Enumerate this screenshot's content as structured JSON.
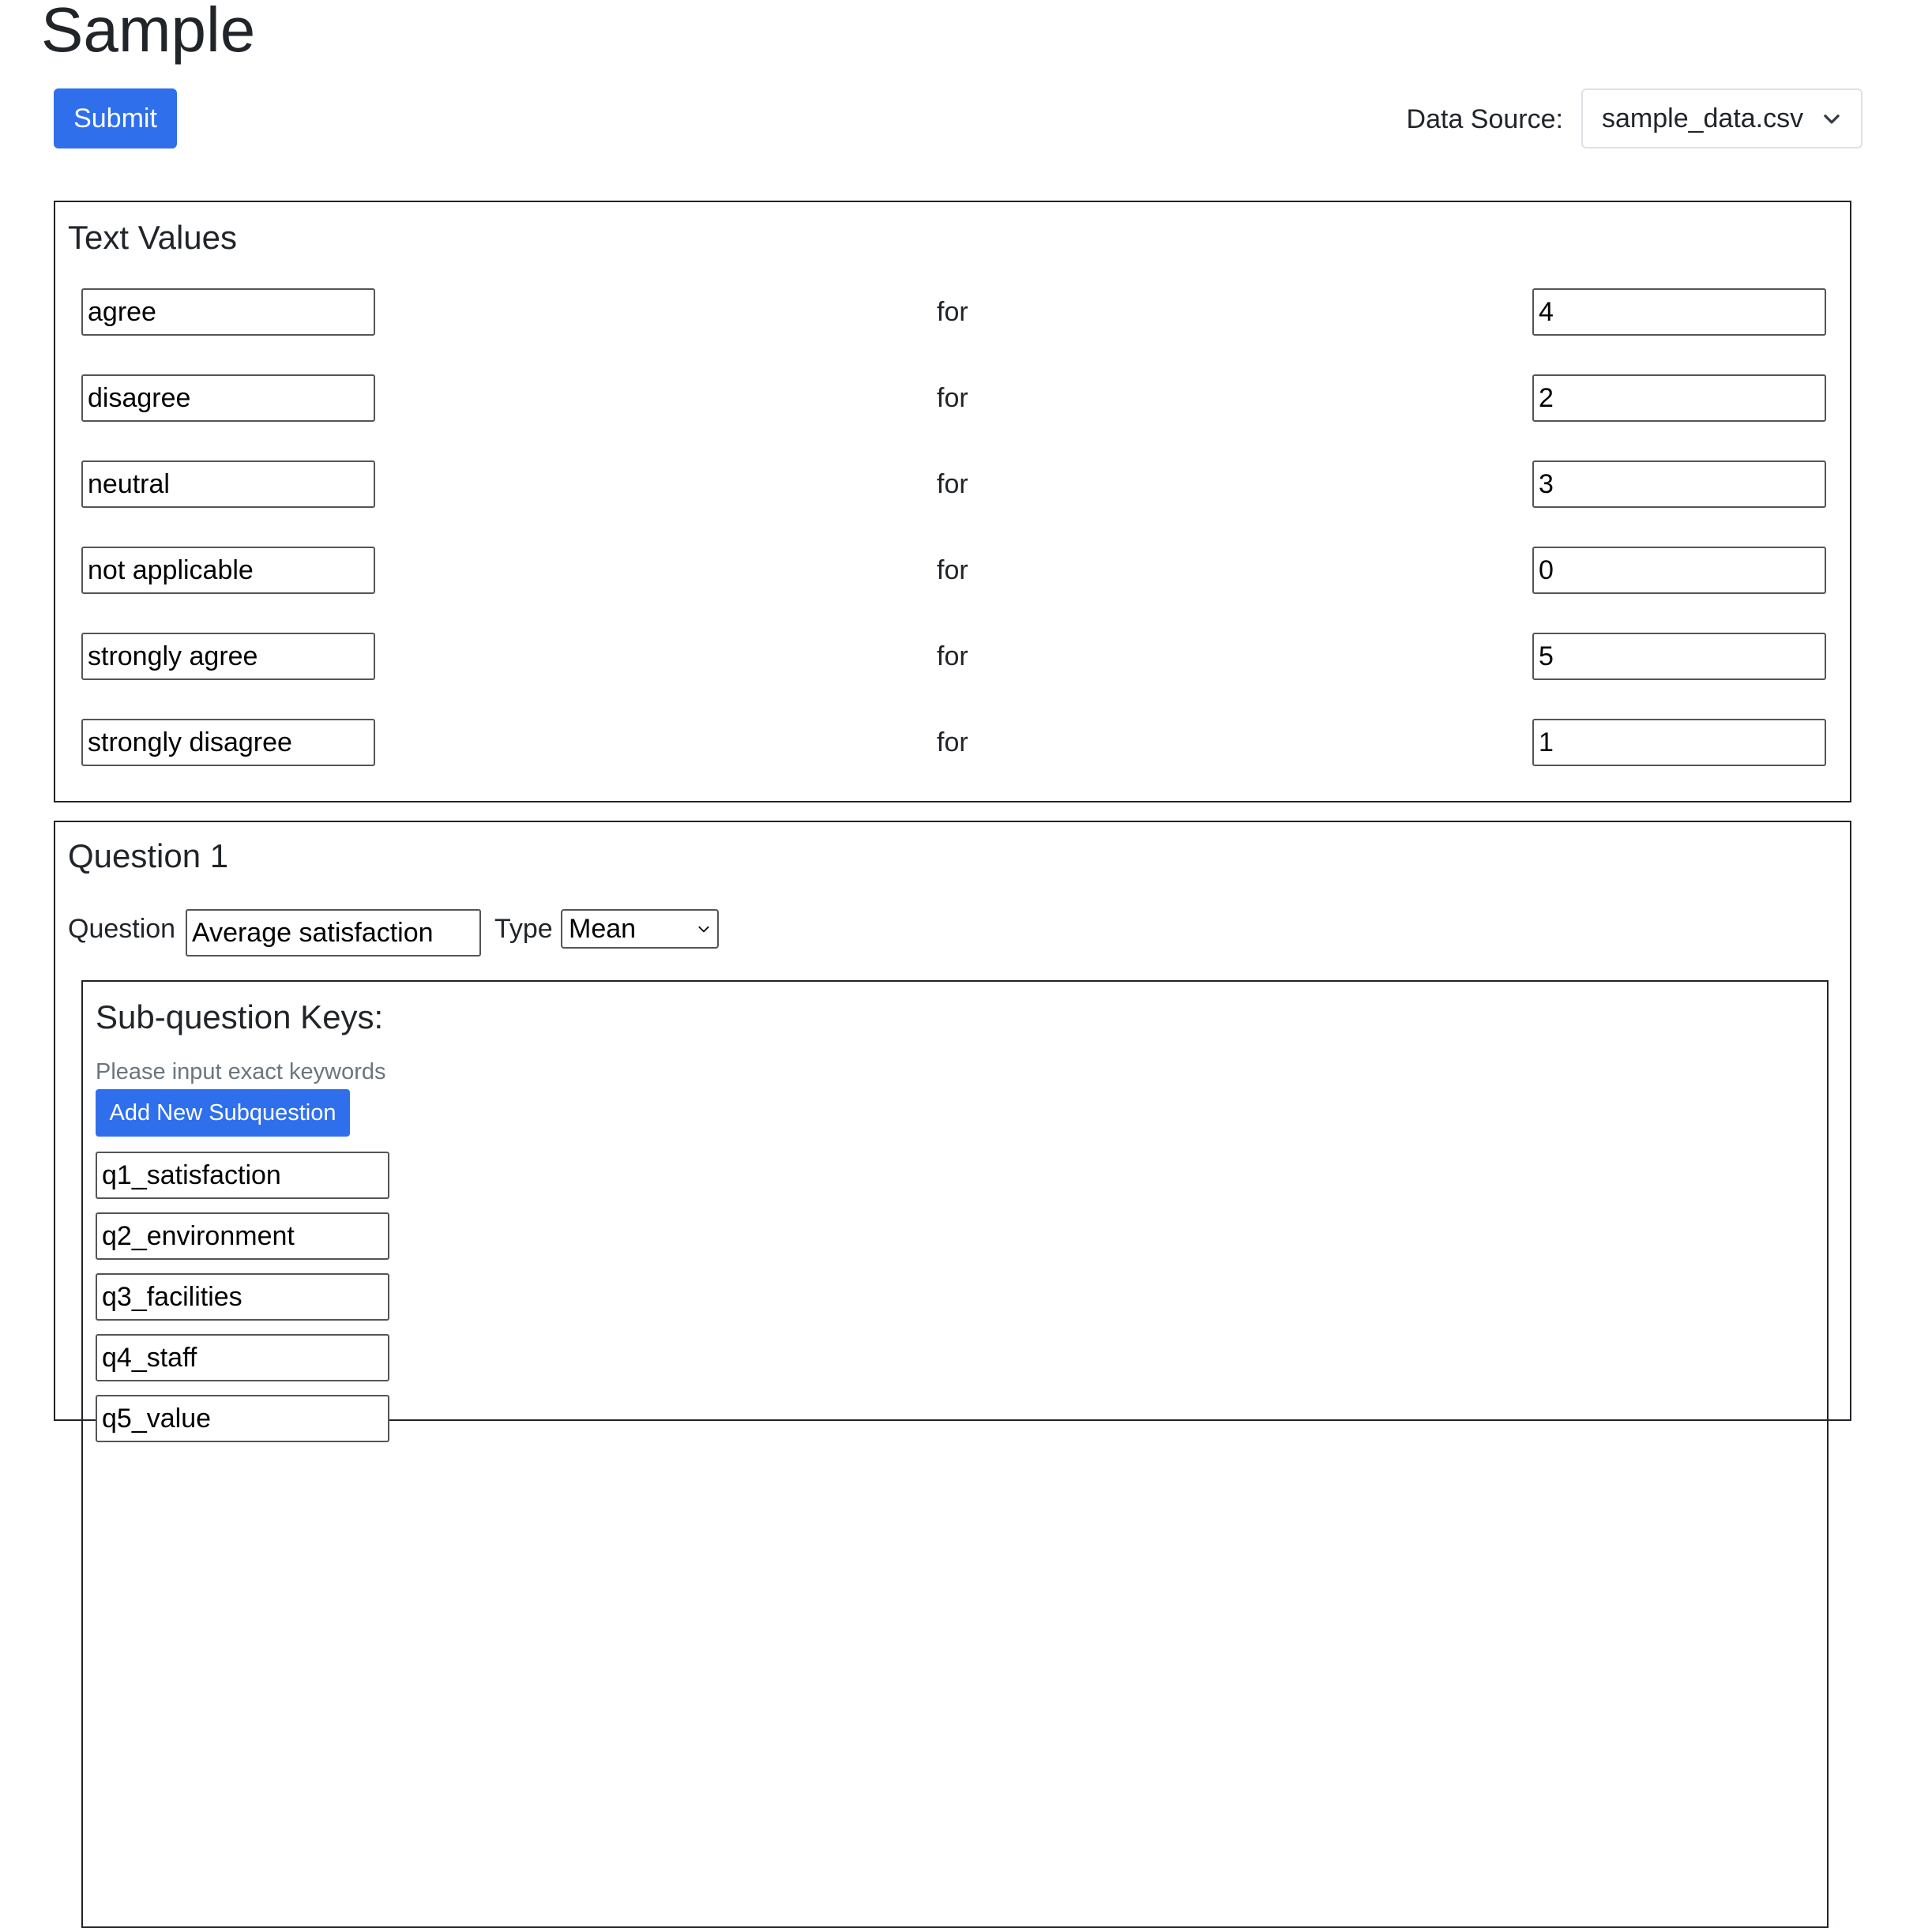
{
  "header": {
    "title": "Sample",
    "submit_label": "Submit",
    "data_source_label": "Data Source:",
    "data_source_value": "sample_data.csv"
  },
  "text_values": {
    "title": "Text Values",
    "connector": "for",
    "rows": [
      {
        "text": "agree",
        "value": "4"
      },
      {
        "text": "disagree",
        "value": "2"
      },
      {
        "text": "neutral",
        "value": "3"
      },
      {
        "text": "not applicable",
        "value": "0"
      },
      {
        "text": "strongly agree",
        "value": "5"
      },
      {
        "text": "strongly disagree",
        "value": "1"
      }
    ]
  },
  "question1": {
    "title": "Question 1",
    "question_label": "Question",
    "question_value": "Average satisfaction",
    "type_label": "Type",
    "type_value": "Mean",
    "subquestions": {
      "title": "Sub-question Keys:",
      "hint": "Please input exact keywords",
      "add_label": "Add New Subquestion",
      "keys": [
        "q1_satisfaction",
        "q2_environment",
        "q3_facilities",
        "q4_staff",
        "q5_value"
      ]
    }
  }
}
